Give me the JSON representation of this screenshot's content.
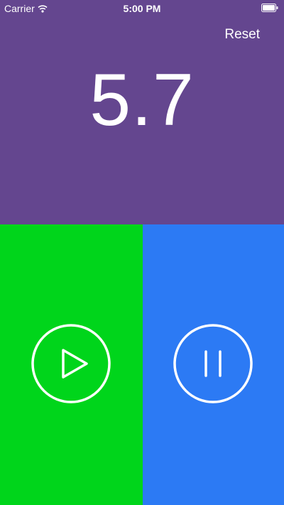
{
  "status_bar": {
    "carrier": "Carrier",
    "time": "5:00 PM"
  },
  "toolbar": {
    "reset_label": "Reset"
  },
  "timer": {
    "value": "5.7"
  },
  "controls": {
    "play_icon": "play-circle-icon",
    "pause_icon": "pause-circle-icon"
  },
  "colors": {
    "top_background": "#64468F",
    "play_background": "#00D51B",
    "pause_background": "#2C7AF4",
    "foreground": "#FFFFFF"
  }
}
